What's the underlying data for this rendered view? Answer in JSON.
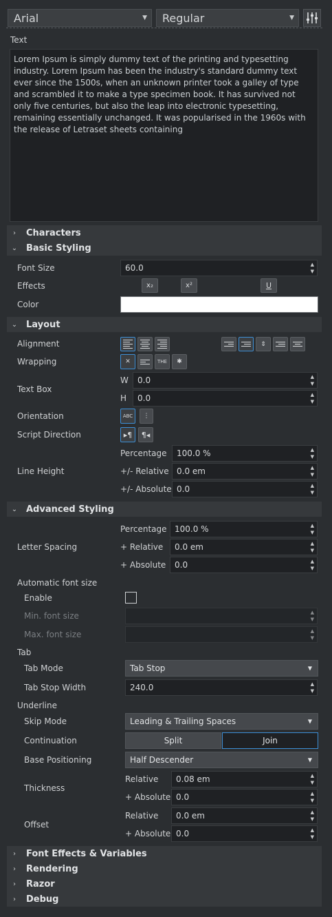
{
  "toolbar": {
    "font_family": "Arial",
    "font_style": "Regular",
    "settings_icon": "sliders-icon"
  },
  "text_section": {
    "label": "Text",
    "value": "Lorem Ipsum is simply dummy text of the printing and typesetting industry. Lorem Ipsum has been the industry's standard dummy text ever since the 1500s, when an unknown printer took a galley of type and scrambled it to make a type specimen book. It has survived not only five centuries, but also the leap into electronic typesetting, remaining essentially unchanged. It was popularised in the 1960s with the release of Letraset sheets containing"
  },
  "sections": {
    "characters": "Characters",
    "basic_styling": "Basic Styling",
    "layout": "Layout",
    "advanced_styling": "Advanced Styling",
    "font_effects": "Font Effects & Variables",
    "rendering": "Rendering",
    "razor": "Razor",
    "debug": "Debug"
  },
  "basic": {
    "font_size_label": "Font Size",
    "font_size": "60.0",
    "effects_label": "Effects",
    "subscript": "x₂",
    "superscript": "x²",
    "underline": "U",
    "color_label": "Color",
    "color_value": "#ffffff"
  },
  "layout": {
    "alignment_label": "Alignment",
    "wrapping_label": "Wrapping",
    "textbox_label": "Text Box",
    "w_label": "W",
    "w_value": "0.0",
    "h_label": "H",
    "h_value": "0.0",
    "orientation_label": "Orientation",
    "orientation_h": "ABC",
    "script_direction_label": "Script Direction",
    "line_height_label": "Line Height",
    "lh_percentage_label": "Percentage",
    "lh_percentage": "100.0 %",
    "lh_relative_label": "+/- Relative",
    "lh_relative": "0.0 em",
    "lh_absolute_label": "+/- Absolute",
    "lh_absolute": "0.0"
  },
  "advanced": {
    "letter_spacing_label": "Letter Spacing",
    "ls_percentage_label": "Percentage",
    "ls_percentage": "100.0 %",
    "ls_relative_label": "+ Relative",
    "ls_relative": "0.0 em",
    "ls_absolute_label": "+ Absolute",
    "ls_absolute": "0.0",
    "auto_font_label": "Automatic font size",
    "enable_label": "Enable",
    "enable_checked": false,
    "min_font_label": "Min. font size",
    "max_font_label": "Max. font size",
    "tab_label": "Tab",
    "tab_mode_label": "Tab Mode",
    "tab_mode": "Tab Stop",
    "tab_stop_width_label": "Tab Stop Width",
    "tab_stop_width": "240.0",
    "underline_label": "Underline",
    "skip_mode_label": "Skip Mode",
    "skip_mode": "Leading & Trailing Spaces",
    "continuation_label": "Continuation",
    "split": "Split",
    "join": "Join",
    "base_positioning_label": "Base Positioning",
    "base_positioning": "Half Descender",
    "thickness_label": "Thickness",
    "th_relative_label": "Relative",
    "th_relative": "0.08 em",
    "th_absolute_label": "+ Absolute",
    "th_absolute": "0.0",
    "offset_label": "Offset",
    "of_relative_label": "Relative",
    "of_relative": "0.0 em",
    "of_absolute_label": "+ Absolute",
    "of_absolute": "0.0"
  },
  "colors": {
    "background": "#2b2e31",
    "section_header": "#36393c",
    "field": "#1f2124",
    "accent": "#3d8fd6"
  }
}
